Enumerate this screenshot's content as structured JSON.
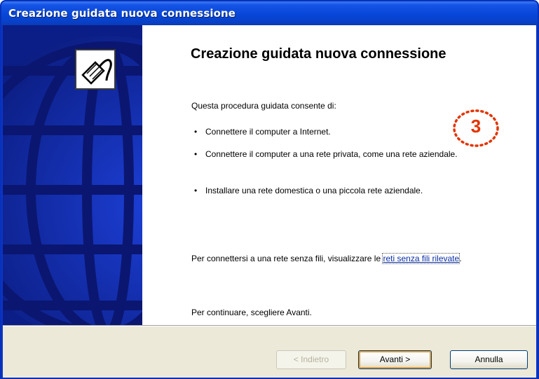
{
  "window": {
    "title": "Creazione guidata nuova connessione"
  },
  "wizard": {
    "icon": "network-cable-icon",
    "banner_image": "globe-graphic",
    "heading": "Creazione guidata nuova connessione",
    "intro": "Questa procedura guidata consente di:",
    "bullets": [
      "Connettere il computer a Internet.",
      "Connettere il computer a una rete privata, come una rete aziendale.",
      "Installare una rete domestica o una piccola rete aziendale."
    ],
    "wireless_prefix": "Per connettersi a una rete senza fili, visualizzare le",
    "wireless_link": "reti senza fili rilevate",
    "wireless_suffix": ".",
    "continue_text": "Per continuare, scegliere Avanti."
  },
  "step_badge": {
    "number": "3",
    "color": "#e23400"
  },
  "footer": {
    "back_label": "< Indietro",
    "next_label": "Avanti >",
    "cancel_label": "Annulla"
  },
  "colors": {
    "titlebar": "#0746d8",
    "banner": "#0c1f8a",
    "footer": "#ece9d8",
    "link": "#0a2fa8"
  }
}
